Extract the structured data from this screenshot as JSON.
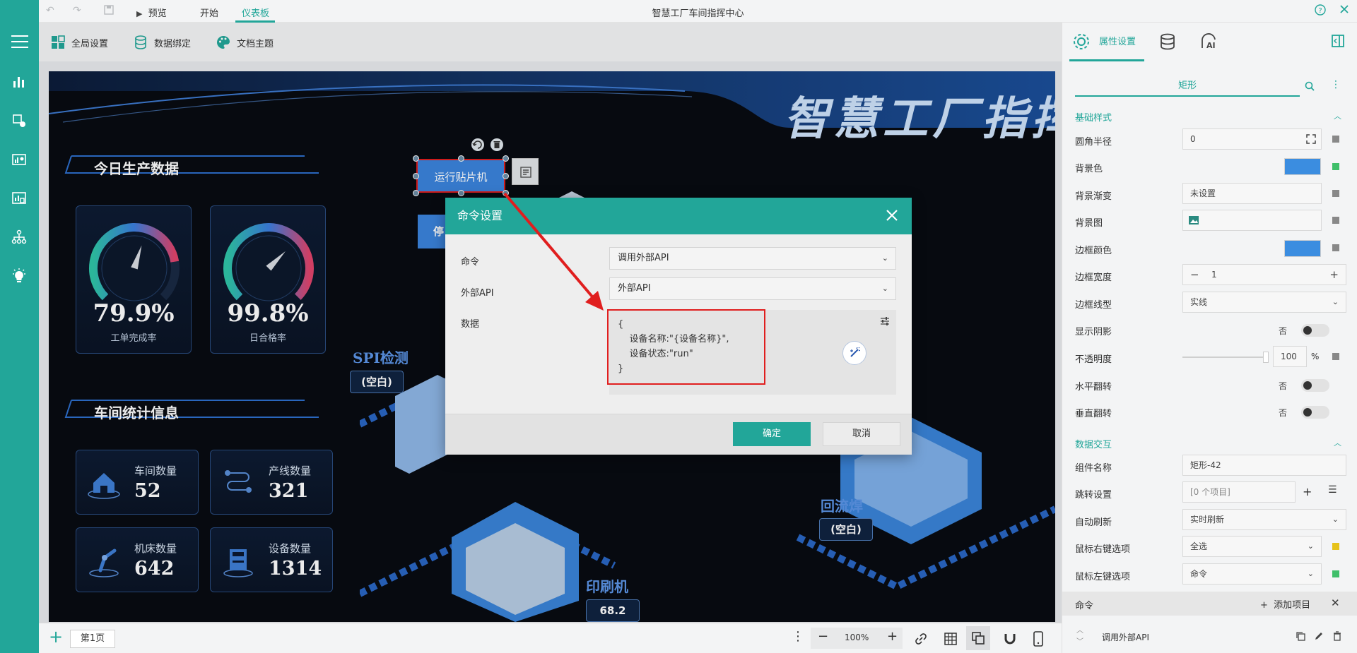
{
  "app": {
    "title": "智慧工厂车间指挥中心"
  },
  "topbar": {
    "preview": "预览",
    "start": "开始",
    "dashboard": "仪表板"
  },
  "toolbar": {
    "global_settings": "全局设置",
    "data_binding": "数据绑定",
    "doc_theme": "文档主题"
  },
  "dashboard": {
    "title": "智慧工厂指挥",
    "today_production": "今日生产数据",
    "workshop_stats": "车间统计信息",
    "gauges": [
      {
        "value": "79.9%",
        "label": "工单完成率",
        "level": 0.799
      },
      {
        "value": "99.8%",
        "label": "日合格率",
        "level": 0.998
      }
    ],
    "stats": [
      {
        "label": "车间数量",
        "value": "52"
      },
      {
        "label": "产线数量",
        "value": "321"
      },
      {
        "label": "机床数量",
        "value": "642"
      },
      {
        "label": "设备数量",
        "value": "1314"
      }
    ],
    "selected_button": "运行贴片机",
    "partial_button": "停",
    "areas": [
      {
        "name": "SPI检测",
        "value": "(空白)"
      },
      {
        "name": "回流焊",
        "value": "(空白)"
      },
      {
        "name": "印刷机",
        "value": "68.2"
      }
    ]
  },
  "modal": {
    "title": "命令设置",
    "command_label": "命令",
    "command_value": "调用外部API",
    "api_label": "外部API",
    "api_value": "外部API",
    "data_label": "数据",
    "code_lines": [
      "{",
      "    设备名称:\"{设备名称}\",",
      "    设备状态:\"run\"",
      "}"
    ],
    "ok": "确定",
    "cancel": "取消"
  },
  "panel": {
    "tab_properties": "属性设置",
    "subtab": "矩形",
    "basic_style": "基础样式",
    "corner_radius_label": "圆角半径",
    "corner_radius_value": "0",
    "bg_color_label": "背景色",
    "bg_gradient_label": "背景渐变",
    "bg_gradient_value": "未设置",
    "bg_image_label": "背景图",
    "border_color_label": "边框颜色",
    "border_width_label": "边框宽度",
    "border_width_value": "1",
    "border_style_label": "边框线型",
    "border_style_value": "实线",
    "shadow_label": "显示阴影",
    "shadow_value": "否",
    "opacity_label": "不透明度",
    "opacity_value": "100",
    "opacity_unit": "%",
    "hflip_label": "水平翻转",
    "hflip_value": "否",
    "vflip_label": "垂直翻转",
    "vflip_value": "否",
    "data_interaction": "数据交互",
    "component_name_label": "组件名称",
    "component_name_value": "矩形-42",
    "jump_label": "跳转设置",
    "jump_value": "[0 个项目]",
    "auto_refresh_label": "自动刷新",
    "auto_refresh_value": "实时刷新",
    "right_click_label": "鼠标右键选项",
    "right_click_value": "全选",
    "left_click_label": "鼠标左键选项",
    "left_click_value": "命令",
    "command_section": "命令",
    "add_item": "添加项目",
    "command_item": "调用外部API"
  },
  "bottombar": {
    "page_tab": "第1页",
    "zoom": "100%"
  },
  "colors": {
    "accent": "#22a699",
    "swatch": "#3b8de0",
    "highlight": "#e01e1e"
  }
}
